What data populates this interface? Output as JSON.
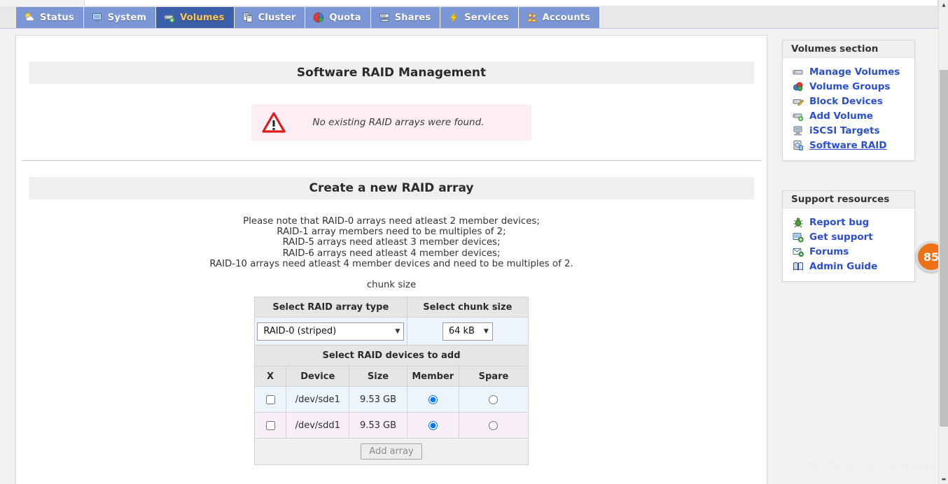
{
  "tabs": [
    {
      "label": "Status",
      "icon": "weather-sun-cloud-icon",
      "active": false
    },
    {
      "label": "System",
      "icon": "monitor-icon",
      "active": false
    },
    {
      "label": "Volumes",
      "icon": "drive-add-icon",
      "active": true
    },
    {
      "label": "Cluster",
      "icon": "server-stack-icon",
      "active": false
    },
    {
      "label": "Quota",
      "icon": "pie-chart-icon",
      "active": false
    },
    {
      "label": "Shares",
      "icon": "shared-drive-icon",
      "active": false
    },
    {
      "label": "Services",
      "icon": "lightning-bolt-icon",
      "active": false
    },
    {
      "label": "Accounts",
      "icon": "users-icon",
      "active": false
    }
  ],
  "main": {
    "page_title": "Software RAID Management",
    "warning": {
      "icon": "warning-triangle-icon",
      "text": "No existing RAID arrays were found."
    },
    "create_title": "Create a new RAID array",
    "notes": [
      "Please note that RAID-0 arrays need atleast 2 member devices;",
      "RAID-1 array members need to be multiples of 2;",
      "RAID-5 arrays need atleast 3 member devices;",
      "RAID-6 arrays need atleast 4 member devices;",
      "RAID-10 arrays need atleast 4 member devices and need to be multiples of 2."
    ],
    "chunk_caption": "chunk size",
    "form": {
      "raid_type_header": "Select RAID array type",
      "chunk_size_header": "Select chunk size",
      "raid_type_value": "RAID-0 (striped)",
      "chunk_size_value": "64 kB",
      "devices_header": "Select RAID devices to add",
      "columns": [
        "X",
        "Device",
        "Size",
        "Member",
        "Spare"
      ],
      "rows": [
        {
          "device": "/dev/sde1",
          "size": "9.53 GB",
          "checked": false,
          "member": true,
          "spare": false
        },
        {
          "device": "/dev/sdd1",
          "size": "9.53 GB",
          "checked": false,
          "member": true,
          "spare": false
        }
      ],
      "submit_label": "Add array"
    }
  },
  "sidebar": {
    "volumes": {
      "title": "Volumes section",
      "items": [
        {
          "label": "Manage Volumes",
          "icon": "drive-icon",
          "current": false
        },
        {
          "label": "Volume Groups",
          "icon": "drive-group-icon",
          "current": false
        },
        {
          "label": "Block Devices",
          "icon": "drive-edit-icon",
          "current": false
        },
        {
          "label": "Add Volume",
          "icon": "drive-add-icon",
          "current": false
        },
        {
          "label": "iSCSI Targets",
          "icon": "server-icon",
          "current": false
        },
        {
          "label": "Software RAID",
          "icon": "drive-disk-icon",
          "current": true
        }
      ]
    },
    "support": {
      "title": "Support resources",
      "items": [
        {
          "label": "Report bug",
          "icon": "bug-icon"
        },
        {
          "label": "Get support",
          "icon": "support-icon"
        },
        {
          "label": "Forums",
          "icon": "forum-icon"
        },
        {
          "label": "Admin Guide",
          "icon": "book-icon"
        }
      ]
    }
  },
  "score_badge": {
    "value": "85"
  },
  "watermark": {
    "text": "https://blog.csdn.net/Hhytyq"
  },
  "scrollbar": {
    "up_arrow": "▲",
    "down_arrow": "▬"
  },
  "colors": {
    "tab_bg": "#7b97d6",
    "tab_active_bg": "#3a5fa8",
    "tab_active_text": "#ffc94d",
    "link": "#2b4fd0",
    "warning_bg": "#fdeef5",
    "warning_red": "#e01b1b",
    "badge_orange": "#ee7215",
    "row_blue": "#edf4fb",
    "row_pink": "#f8eef8"
  }
}
